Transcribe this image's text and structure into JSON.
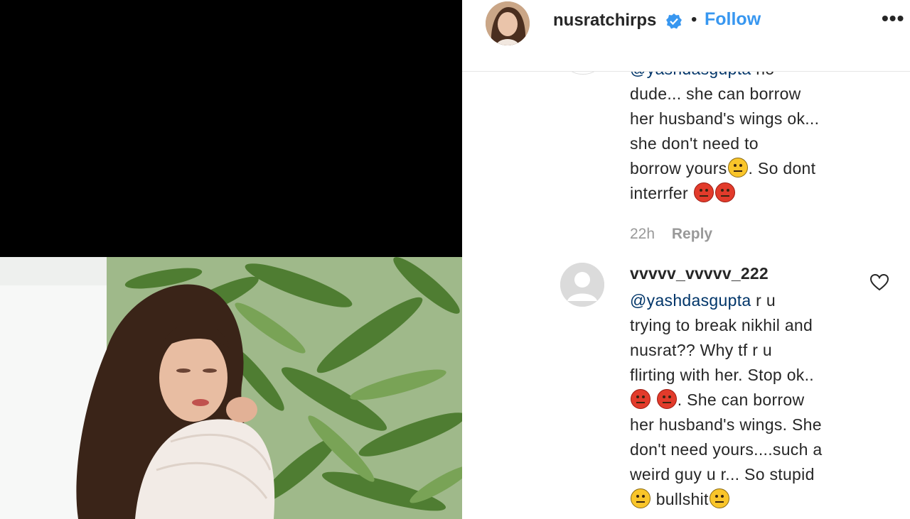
{
  "header": {
    "username": "nusratchirps",
    "separator": "•",
    "follow_label": "Follow",
    "more_label": "•••"
  },
  "comment1": {
    "mention": "@yashdasgupta",
    "mention_suffix": "no",
    "line1": "dude... she can borrow",
    "line2": "her husband's wings ok...",
    "line3": "she don't need to",
    "line4a": "borrow yours",
    "line4b": ". So dont",
    "line5": "interrfer",
    "time": "22h",
    "reply_label": "Reply"
  },
  "comment2": {
    "username": "vvvvv_vvvvv_222",
    "mention": "@yashdasgupta",
    "mention_suffix": " r u",
    "line1": "trying to break nikhil and",
    "line2": "nusrat?? Why tf r u",
    "line3": "flirting with her. Stop ok..",
    "line4": ". She can borrow",
    "line5": "her husband's wings. She",
    "line6": "don't need yours....such a",
    "line7": "weird guy u r... So stupid",
    "line8": " bullshit"
  },
  "icons": {
    "verified": "verified-badge-icon",
    "heart": "heart-icon",
    "angry": "angry-face-icon",
    "neutral": "neutral-face-icon",
    "expressionless": "expressionless-face-icon"
  },
  "colors": {
    "follow": "#3897f0",
    "mention": "#003569",
    "meta": "#999999"
  }
}
